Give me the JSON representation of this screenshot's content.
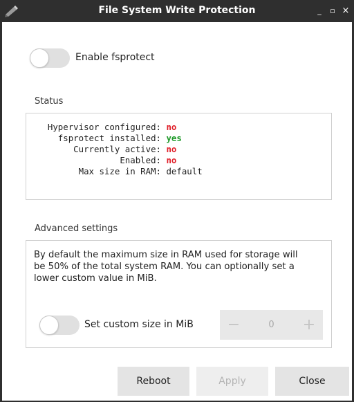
{
  "window": {
    "title": "File System Write Protection",
    "icon": "pencil-app-icon",
    "controls": {
      "minimize": "_",
      "maximize": "▫",
      "close": "×"
    }
  },
  "enable_toggle": {
    "label": "Enable fsprotect",
    "on": false
  },
  "status": {
    "title": "Status",
    "rows": [
      {
        "key": "Hypervisor configured:",
        "value": "no",
        "state": "no"
      },
      {
        "key": "fsprotect installed:",
        "value": "yes",
        "state": "yes"
      },
      {
        "key": "Currently active:",
        "value": "no",
        "state": "no"
      },
      {
        "key": "Enabled:",
        "value": "no",
        "state": "no"
      },
      {
        "key": "Max size in RAM:",
        "value": "default",
        "state": "default"
      }
    ]
  },
  "advanced": {
    "title": "Advanced settings",
    "description": "By default the maximum size in RAM used for storage will be 50% of the total system RAM.  You can optionally set a lower custom value in MiB.",
    "custom_toggle": {
      "label": "Set custom size in MiB",
      "on": false
    },
    "stepper": {
      "value": "0",
      "minus": "−",
      "plus": "+"
    }
  },
  "buttons": {
    "reboot": "Reboot",
    "apply": "Apply",
    "close": "Close"
  },
  "colors": {
    "no": "#e0202a",
    "yes": "#1f9a2a",
    "titlebar": "#2f2f2f"
  }
}
